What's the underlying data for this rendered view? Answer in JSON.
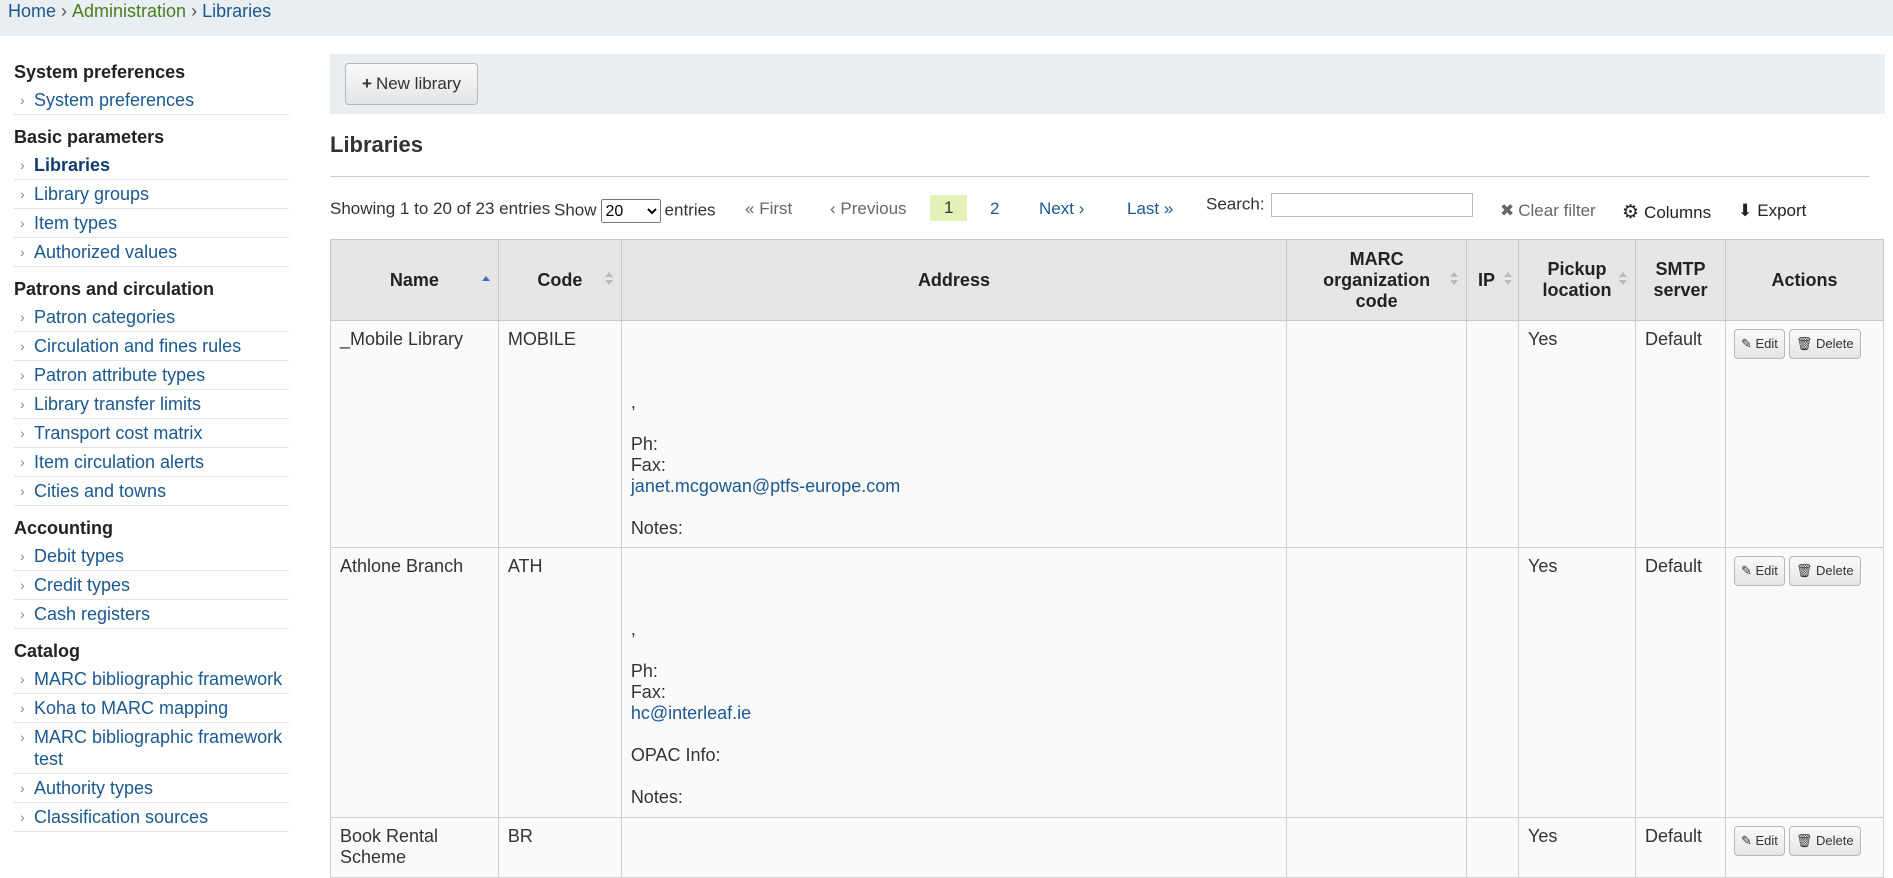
{
  "breadcrumb": {
    "home": "Home",
    "admin": "Administration",
    "current": "Libraries"
  },
  "sidebar": {
    "sections": [
      {
        "title": "System preferences",
        "items": [
          "System preferences"
        ]
      },
      {
        "title": "Basic parameters",
        "items": [
          "Libraries",
          "Library groups",
          "Item types",
          "Authorized values"
        ]
      },
      {
        "title": "Patrons and circulation",
        "items": [
          "Patron categories",
          "Circulation and fines rules",
          "Patron attribute types",
          "Library transfer limits",
          "Transport cost matrix",
          "Item circulation alerts",
          "Cities and towns"
        ]
      },
      {
        "title": "Accounting",
        "items": [
          "Debit types",
          "Credit types",
          "Cash registers"
        ]
      },
      {
        "title": "Catalog",
        "items": [
          "MARC bibliographic framework",
          "Koha to MARC mapping",
          "MARC bibliographic framework test",
          "Authority types",
          "Classification sources"
        ]
      }
    ],
    "active": "Libraries"
  },
  "toolbar": {
    "new_library": "New library"
  },
  "page_title": "Libraries",
  "controls": {
    "info": "Showing 1 to 20 of 23 entries",
    "show_label": "Show",
    "show_value": "20",
    "entries_label": "entries",
    "first": "First",
    "previous": "Previous",
    "page1": "1",
    "page2": "2",
    "next": "Next",
    "last": "Last",
    "search_label": "Search:",
    "search_value": "",
    "clear_filter": "Clear filter",
    "columns": "Columns",
    "export": "Export"
  },
  "table": {
    "headers": {
      "name": "Name",
      "code": "Code",
      "address": "Address",
      "marc_line1": "MARC",
      "marc_line2": "organization",
      "marc_line3": "code",
      "ip": "IP",
      "pickup_line1": "Pickup",
      "pickup_line2": "location",
      "smtp_line1": "SMTP",
      "smtp_line2": "server",
      "actions": "Actions"
    },
    "edit_label": "Edit",
    "delete_label": "Delete",
    "rows": [
      {
        "name": "_Mobile Library",
        "code": "MOBILE",
        "comma": ",",
        "phone": "Ph:",
        "fax": "Fax:",
        "email": "janet.mcgowan@ptfs-europe.com",
        "notes": "Notes:",
        "pickup": "Yes",
        "smtp": "Default"
      },
      {
        "name": "Athlone Branch",
        "code": "ATH",
        "comma": ",",
        "phone": "Ph:",
        "fax": "Fax:",
        "email": "hc@interleaf.ie",
        "opac": "OPAC Info:",
        "notes": "Notes:",
        "pickup": "Yes",
        "smtp": "Default"
      },
      {
        "name": "Book Rental Scheme",
        "code": "BR",
        "pickup": "Yes",
        "smtp": "Default"
      }
    ]
  }
}
